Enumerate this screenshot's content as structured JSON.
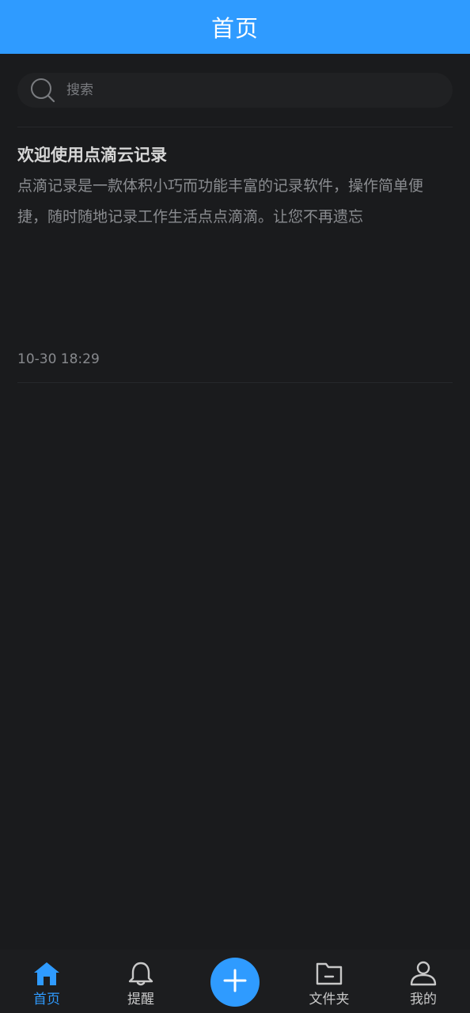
{
  "header": {
    "title": "首页"
  },
  "search": {
    "placeholder": "搜索",
    "value": ""
  },
  "notes": [
    {
      "title": "欢迎使用点滴云记录",
      "body": "点滴记录是一款体积小巧而功能丰富的记录软件，操作简单便捷，随时随地记录工作生活点点滴滴。让您不再遗忘",
      "time": "10-30 18:29"
    }
  ],
  "tabbar": {
    "items": [
      {
        "label": "首页",
        "icon": "home-icon",
        "active": true
      },
      {
        "label": "提醒",
        "icon": "bell-icon",
        "active": false
      },
      {
        "label": "文件夹",
        "icon": "folder-icon",
        "active": false
      },
      {
        "label": "我的",
        "icon": "user-icon",
        "active": false
      }
    ],
    "add_icon": "plus-icon"
  },
  "colors": {
    "accent": "#2f9bff",
    "background": "#1a1b1d",
    "search_bg": "#202123",
    "tab_inactive": "#c8c8c8"
  }
}
